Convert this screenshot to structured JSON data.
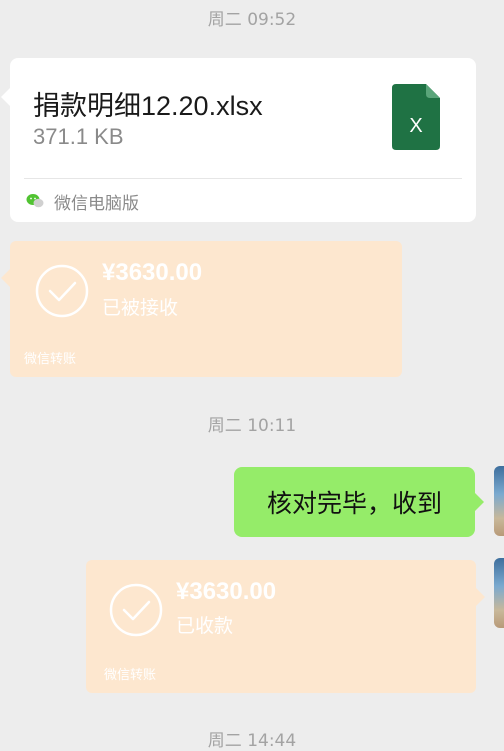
{
  "timestamps": [
    "周二 09:52",
    "周二 10:11",
    "周二 14:44"
  ],
  "file_message": {
    "name": "捐款明细12.20.xlsx",
    "size": "371.1 KB",
    "icon": "excel-xlsx-icon",
    "icon_letter": "X",
    "icon_color": "#1f7244",
    "source": "微信电脑版"
  },
  "transfer_received": {
    "amount": "¥3630.00",
    "status": "已被接收",
    "label": "微信转账",
    "color": "#fde7cf"
  },
  "text_message": {
    "text": "核对完毕，收到",
    "bubble_color": "#95ec69"
  },
  "transfer_sent": {
    "amount": "¥3630.00",
    "status": "已收款",
    "label": "微信转账",
    "color": "#fde7cf"
  }
}
